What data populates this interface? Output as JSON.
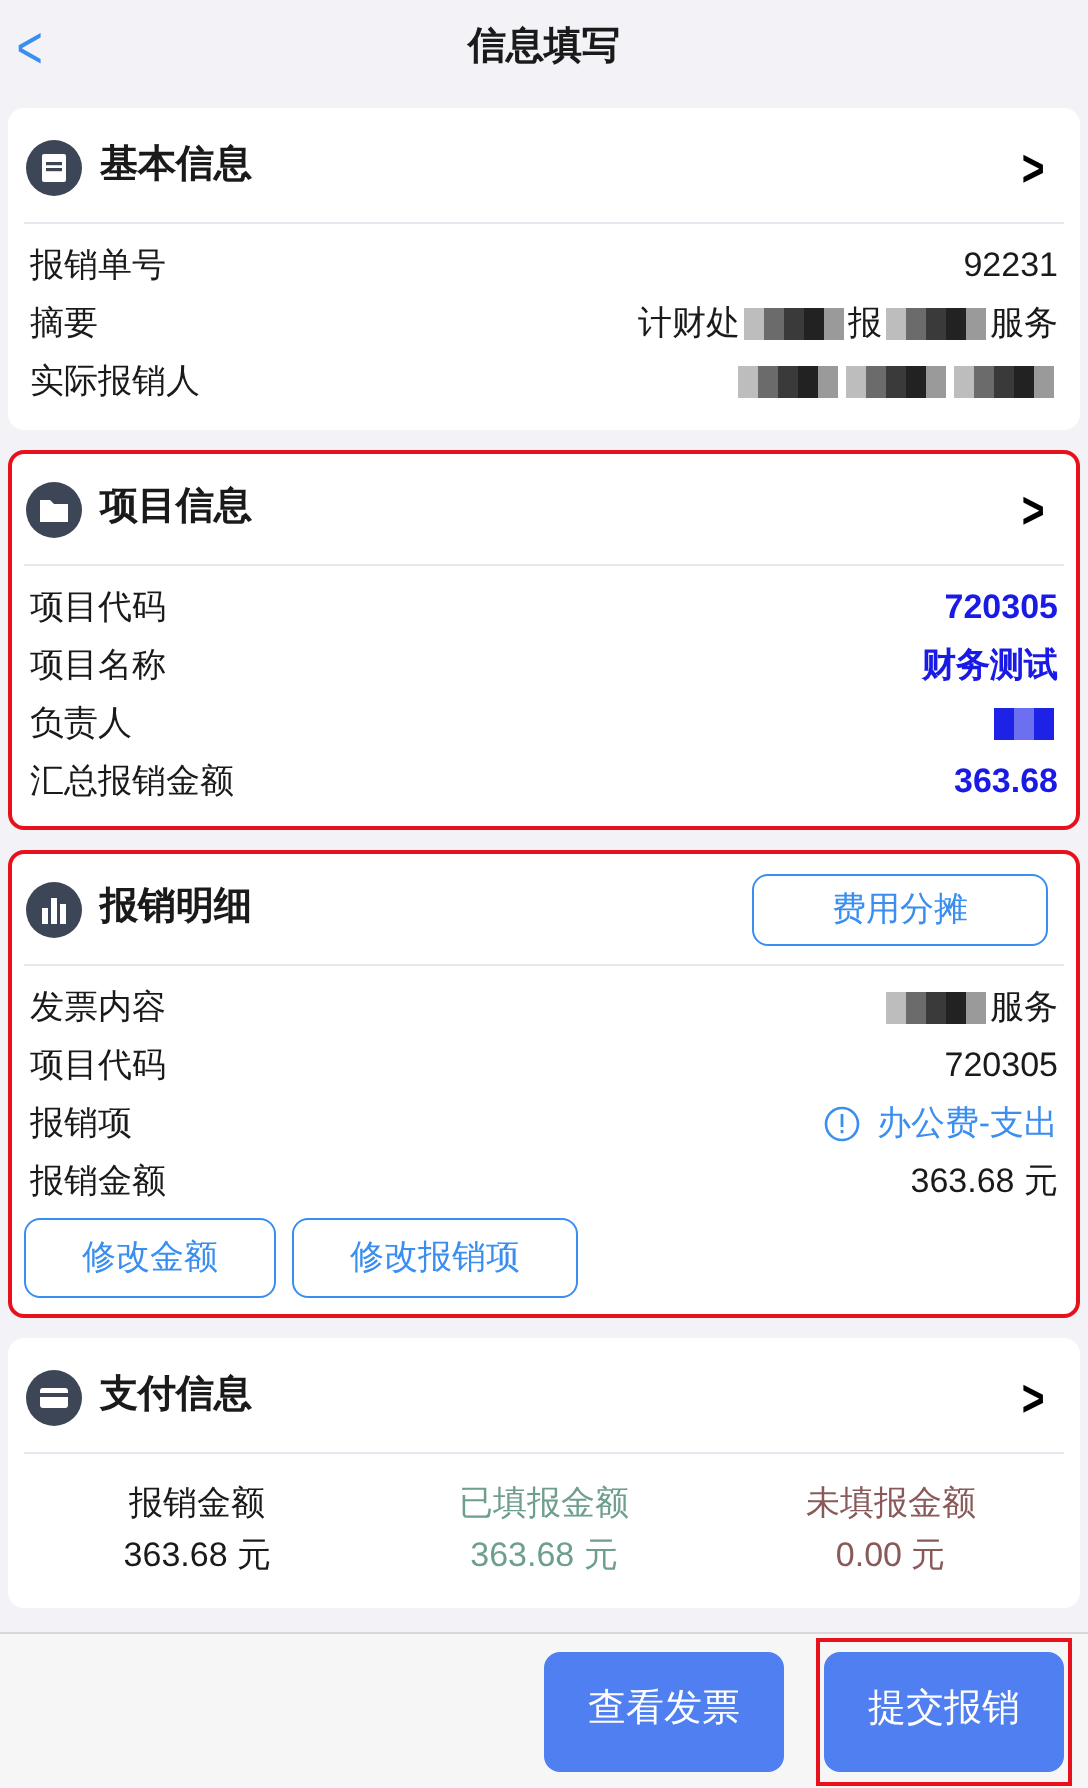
{
  "header": {
    "back": "<",
    "title": "信息填写"
  },
  "sections": [
    {
      "kind": "list",
      "title": "基本信息",
      "chevron": ">",
      "highlighted": false,
      "rows": [
        {
          "label": "报销单号",
          "accent": false,
          "parts": [
            {
              "kind": "text",
              "text": "92231"
            }
          ]
        },
        {
          "label": "摘要",
          "accent": false,
          "parts": [
            {
              "kind": "text",
              "text": "计财处"
            },
            {
              "kind": "redacted"
            },
            {
              "kind": "text",
              "text": "报"
            },
            {
              "kind": "redacted"
            },
            {
              "kind": "text",
              "text": "服务"
            }
          ]
        },
        {
          "label": "实际报销人",
          "accent": false,
          "parts": [
            {
              "kind": "redacted"
            },
            {
              "kind": "redacted"
            },
            {
              "kind": "redacted"
            }
          ]
        }
      ]
    },
    {
      "kind": "list",
      "title": "项目信息",
      "chevron": ">",
      "highlighted": true,
      "rows": [
        {
          "label": "项目代码",
          "accent": true,
          "parts": [
            {
              "kind": "text",
              "text": "720305"
            }
          ]
        },
        {
          "label": "项目名称",
          "accent": true,
          "parts": [
            {
              "kind": "text",
              "text": "财务测试"
            }
          ]
        },
        {
          "label": "负责人",
          "accent": true,
          "parts": [
            {
              "kind": "redacted"
            }
          ]
        },
        {
          "label": "汇总报销金额",
          "accent": true,
          "parts": [
            {
              "kind": "text",
              "text": "363.68"
            }
          ]
        }
      ]
    },
    {
      "kind": "detail",
      "title": "报销明细",
      "action": "费用分摊",
      "highlighted": true,
      "rows": [
        {
          "label": "发票内容",
          "accent": false,
          "parts": [
            {
              "kind": "redacted"
            },
            {
              "kind": "text",
              "text": "服务"
            }
          ]
        },
        {
          "label": "项目代码",
          "accent": false,
          "parts": [
            {
              "kind": "text",
              "text": "720305"
            }
          ]
        },
        {
          "label": "报销项",
          "accent": false,
          "parts": [
            {
              "kind": "alert"
            },
            {
              "kind": "link",
              "text": "办公费-支出"
            }
          ]
        },
        {
          "label": "报销金额",
          "accent": false,
          "parts": [
            {
              "kind": "text",
              "text": "363.68 元"
            }
          ]
        }
      ],
      "buttons": [
        "修改金额",
        "修改报销项"
      ]
    },
    {
      "kind": "summary",
      "title": "支付信息",
      "chevron": ">",
      "highlighted": false,
      "columns": [
        {
          "label": "报销金额",
          "value": "363.68 元",
          "color": "#1a1a1a"
        },
        {
          "label": "已填报金额",
          "value": "363.68 元",
          "color": "#6e9e8c"
        },
        {
          "label": "未填报金额",
          "value": "0.00 元",
          "color": "#8a5a5a"
        }
      ]
    }
  ],
  "footer": {
    "buttons": [
      {
        "label": "查看发票",
        "highlighted": false
      },
      {
        "label": "提交报销",
        "highlighted": true
      }
    ]
  }
}
